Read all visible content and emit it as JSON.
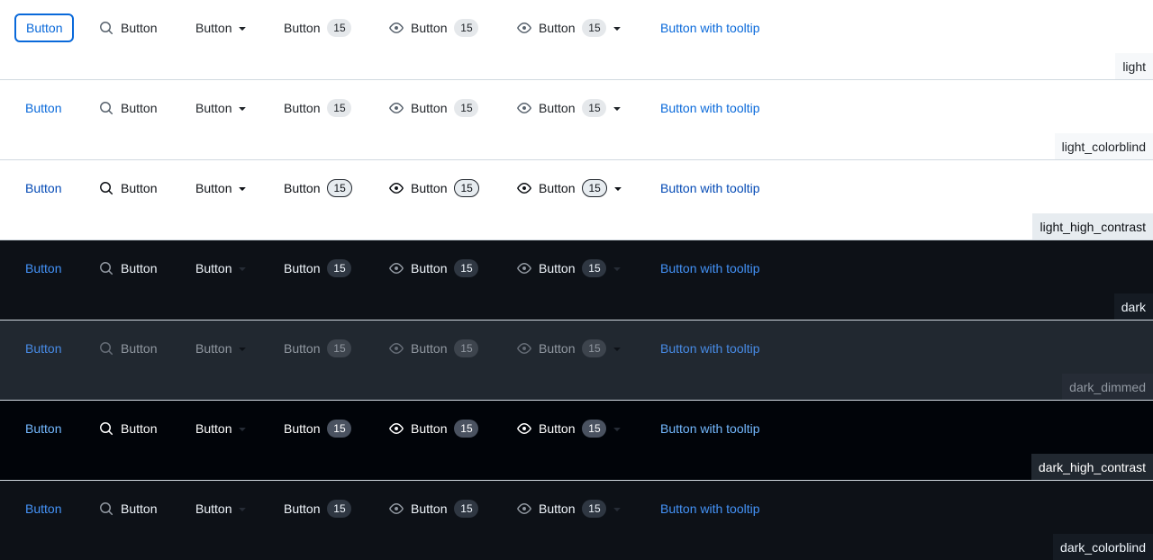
{
  "buttons": {
    "default_label": "Button",
    "counter_value": "15",
    "tooltip_label": "Button with tooltip"
  },
  "themes": [
    {
      "name": "light"
    },
    {
      "name": "light_colorblind"
    },
    {
      "name": "light_high_contrast"
    },
    {
      "name": "dark"
    },
    {
      "name": "dark_dimmed"
    },
    {
      "name": "dark_high_contrast"
    },
    {
      "name": "dark_colorblind"
    }
  ],
  "icons": {
    "search": "search-icon",
    "eye": "eye-icon",
    "caret": "triangle-down-icon"
  },
  "colors": {
    "light_link": "#0969da",
    "dark_link": "#4493f8",
    "dark_bg": "#0d1117",
    "dark_dimmed_bg": "#212830",
    "dark_high_contrast_bg": "#010409"
  }
}
